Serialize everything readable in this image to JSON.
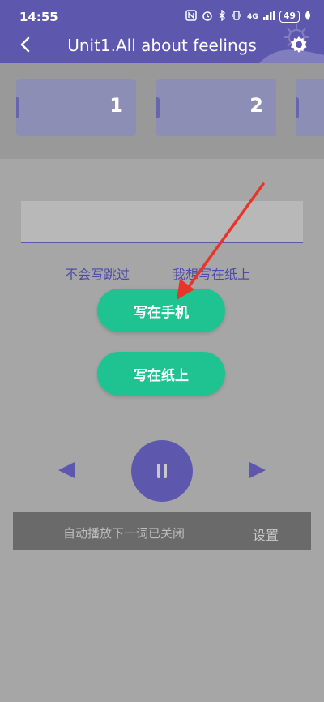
{
  "status": {
    "time": "14:55",
    "signal": "4G",
    "battery": "49"
  },
  "header": {
    "title": "Unit1.All about feelings"
  },
  "tabs": [
    {
      "label": "1"
    },
    {
      "label": "2"
    }
  ],
  "input": {
    "value": ""
  },
  "links": {
    "skip": "不会写跳过",
    "paper_prefer": "我想写在纸上"
  },
  "buttons": {
    "write_phone": "写在手机",
    "write_paper": "写在纸上"
  },
  "notice": {
    "text": "自动播放下一词已关闭",
    "settings": "设置"
  },
  "colors": {
    "header": "#5d58ad",
    "accent_green": "#1fc291",
    "annotation_arrow": "#e8342a"
  }
}
